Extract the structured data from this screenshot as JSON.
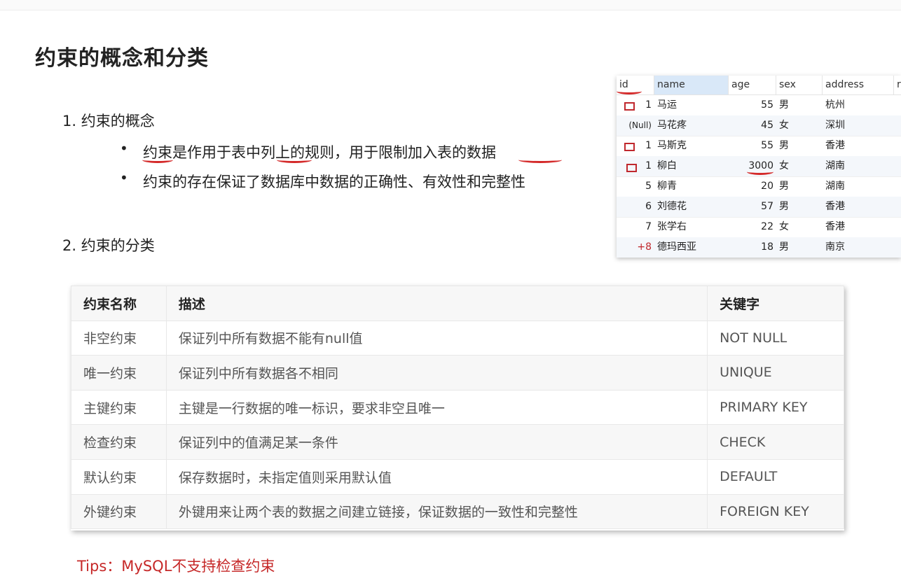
{
  "slide": {
    "title": "约束的概念和分类",
    "section1": "1. 约束的概念",
    "bullets": [
      "约束是作用于表中列上的规则，用于限制加入表的数据",
      "约束的存在保证了数据库中数据的正确性、有效性和完整性"
    ],
    "section2": "2. 约束的分类",
    "tips": "Tips：MySQL不支持检查约束"
  },
  "grid": {
    "columns": [
      "id",
      "name",
      "age",
      "sex",
      "address",
      "r"
    ],
    "rows": [
      {
        "id": "1",
        "name": "马运",
        "age": "55",
        "sex": "男",
        "address": "杭州",
        "key_mark": true
      },
      {
        "id": "(Null)",
        "name": "马花疼",
        "age": "45",
        "sex": "女",
        "address": "深圳",
        "key_mark": false
      },
      {
        "id": "1",
        "name": "马斯克",
        "age": "55",
        "sex": "男",
        "address": "香港",
        "key_mark": true
      },
      {
        "id": "1",
        "name": "柳白",
        "age": "3000",
        "sex": "女",
        "address": "湖南",
        "key_mark": true
      },
      {
        "id": "5",
        "name": "柳青",
        "age": "20",
        "sex": "男",
        "address": "湖南",
        "key_mark": false
      },
      {
        "id": "6",
        "name": "刘德花",
        "age": "57",
        "sex": "男",
        "address": "香港",
        "key_mark": false
      },
      {
        "id": "7",
        "name": "张学右",
        "age": "22",
        "sex": "女",
        "address": "香港",
        "key_mark": false
      },
      {
        "id": "+8",
        "name": "德玛西亚",
        "age": "18",
        "sex": "男",
        "address": "南京",
        "key_mark": false
      }
    ]
  },
  "constraints": {
    "headers": [
      "约束名称",
      "描述",
      "关键字"
    ],
    "rows": [
      [
        "非空约束",
        "保证列中所有数据不能有null值",
        "NOT NULL"
      ],
      [
        "唯一约束",
        "保证列中所有数据各不相同",
        "UNIQUE"
      ],
      [
        "主键约束",
        "主键是一行数据的唯一标识，要求非空且唯一",
        "PRIMARY KEY"
      ],
      [
        "检查约束",
        "保证列中的值满足某一条件",
        "CHECK"
      ],
      [
        "默认约束",
        "保存数据时，未指定值则采用默认值",
        "DEFAULT"
      ],
      [
        "外键约束",
        "外键用来让两个表的数据之间建立链接，保证数据的一致性和完整性",
        "FOREIGN KEY"
      ]
    ]
  }
}
